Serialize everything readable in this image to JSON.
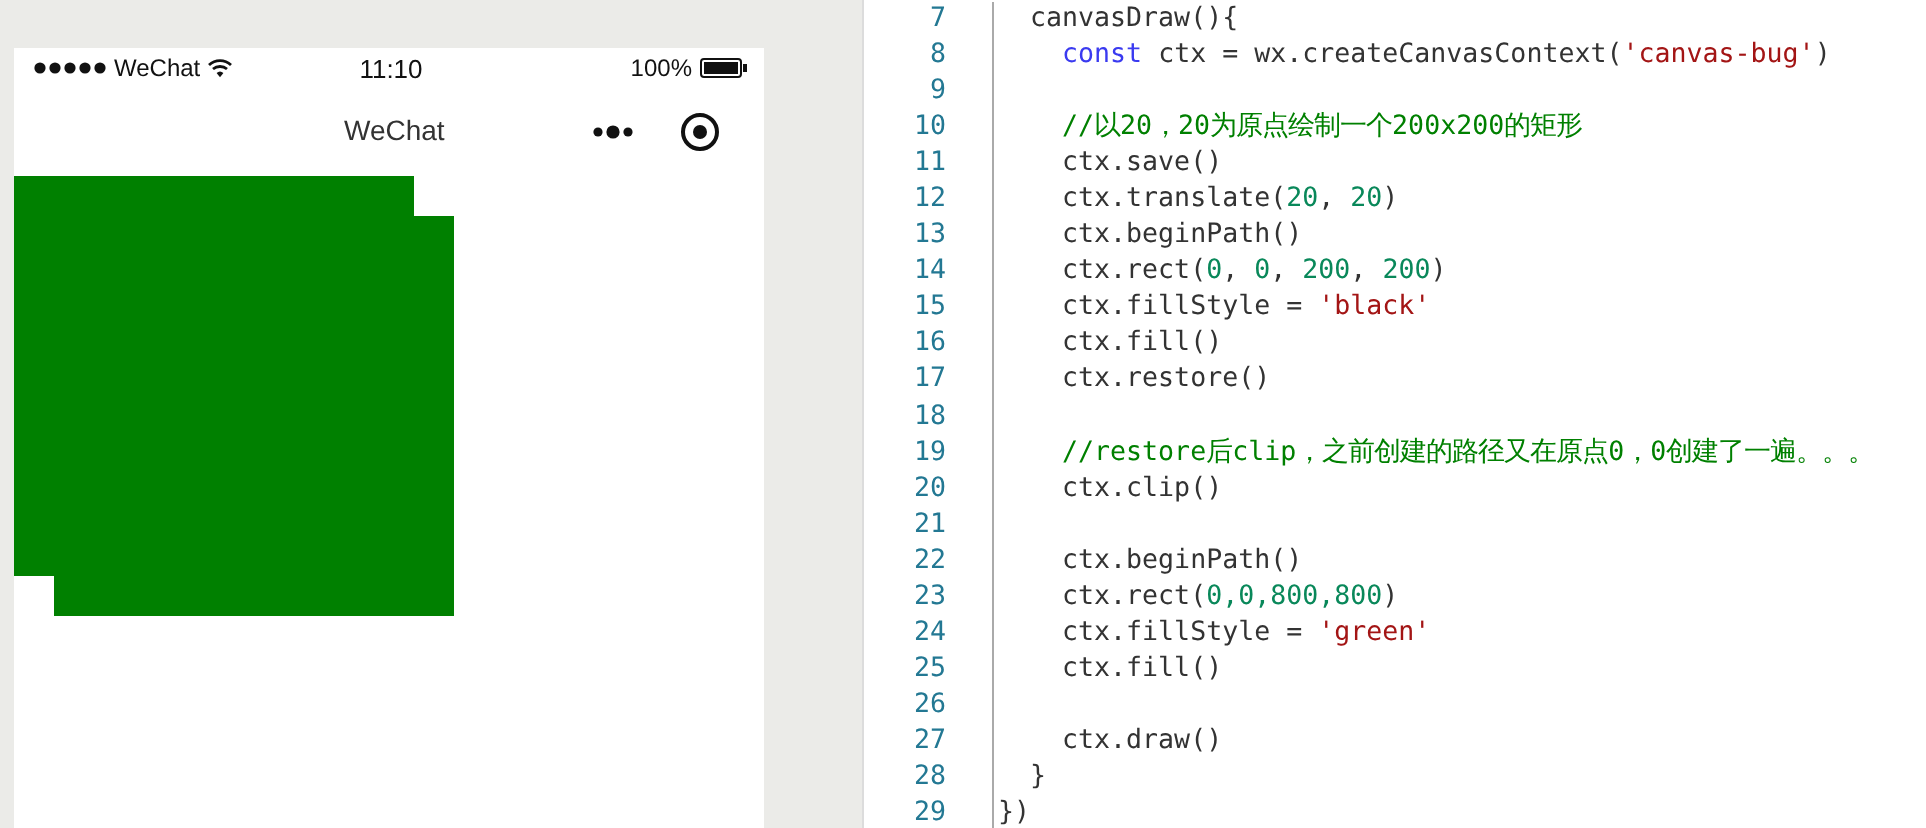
{
  "phone": {
    "status_bar": {
      "carrier": "WeChat",
      "time": "11:10",
      "battery": "100%"
    },
    "nav_bar": {
      "title": "WeChat"
    },
    "canvas": {
      "kind": "drawing"
    }
  },
  "editor": {
    "lines": [
      {
        "number": "7",
        "tokens": [
          {
            "kind": "plain",
            "text": "  canvasDraw(){"
          }
        ]
      },
      {
        "number": "8",
        "tokens": [
          {
            "kind": "keyword",
            "text": "    const"
          },
          {
            "kind": "plain",
            "text": " ctx = wx.createCanvasContext("
          },
          {
            "kind": "string",
            "text": "'canvas-bug'"
          },
          {
            "kind": "plain",
            "text": ")"
          }
        ]
      },
      {
        "number": "9"
      },
      {
        "number": "10",
        "tokens": [
          {
            "kind": "comment",
            "text": "    //以20，20为原点绘制一个200x200的矩形"
          }
        ]
      },
      {
        "number": "11",
        "tokens": [
          {
            "kind": "plain",
            "text": "    ctx.save()"
          }
        ]
      },
      {
        "number": "12",
        "tokens": [
          {
            "kind": "plain",
            "text": "    ctx.translate("
          },
          {
            "kind": "number",
            "text": "20"
          },
          {
            "kind": "plain",
            "text": ", "
          },
          {
            "kind": "number",
            "text": "20"
          },
          {
            "kind": "plain",
            "text": ")"
          }
        ]
      },
      {
        "number": "13",
        "tokens": [
          {
            "kind": "plain",
            "text": "    ctx.beginPath()"
          }
        ]
      },
      {
        "number": "14",
        "tokens": [
          {
            "kind": "plain",
            "text": "    ctx.rect("
          },
          {
            "kind": "number",
            "text": "0"
          },
          {
            "kind": "plain",
            "text": ", "
          },
          {
            "kind": "number",
            "text": "0"
          },
          {
            "kind": "plain",
            "text": ", "
          },
          {
            "kind": "number",
            "text": "200"
          },
          {
            "kind": "plain",
            "text": ", "
          },
          {
            "kind": "number",
            "text": "200"
          },
          {
            "kind": "plain",
            "text": ")"
          }
        ]
      },
      {
        "number": "15",
        "tokens": [
          {
            "kind": "plain",
            "text": "    ctx.fillStyle = "
          },
          {
            "kind": "string",
            "text": "'black'"
          }
        ]
      },
      {
        "number": "16",
        "tokens": [
          {
            "kind": "plain",
            "text": "    ctx.fill()"
          }
        ]
      },
      {
        "number": "17",
        "tokens": [
          {
            "kind": "plain",
            "text": "    ctx.restore()"
          }
        ]
      },
      {
        "number": "18"
      },
      {
        "number": "19",
        "tokens": [
          {
            "kind": "comment",
            "text": "    //restore后clip，之前创建的路径又在原点0，0创建了一遍。。。"
          }
        ]
      },
      {
        "number": "20",
        "tokens": [
          {
            "kind": "plain",
            "text": "    ctx.clip()"
          }
        ]
      },
      {
        "number": "21"
      },
      {
        "number": "22",
        "tokens": [
          {
            "kind": "plain",
            "text": "    ctx.beginPath()"
          }
        ]
      },
      {
        "number": "23",
        "tokens": [
          {
            "kind": "plain",
            "text": "    ctx.rect("
          },
          {
            "kind": "number",
            "text": "0,"
          },
          {
            "kind": "number",
            "text": "0,"
          },
          {
            "kind": "number",
            "text": "800,"
          },
          {
            "kind": "number",
            "text": "800"
          },
          {
            "kind": "plain",
            "text": ")"
          }
        ]
      },
      {
        "number": "24",
        "tokens": [
          {
            "kind": "plain",
            "text": "    ctx.fillStyle = "
          },
          {
            "kind": "string",
            "text": "'green'"
          }
        ]
      },
      {
        "number": "25",
        "tokens": [
          {
            "kind": "plain",
            "text": "    ctx.fill()"
          }
        ]
      },
      {
        "number": "26"
      },
      {
        "number": "27",
        "tokens": [
          {
            "kind": "plain",
            "text": "    ctx.draw()"
          }
        ]
      },
      {
        "number": "28",
        "tokens": [
          {
            "kind": "plain",
            "text": "  }"
          }
        ]
      },
      {
        "number": "29",
        "tokens": [
          {
            "kind": "plain",
            "text": "})"
          }
        ]
      }
    ]
  }
}
